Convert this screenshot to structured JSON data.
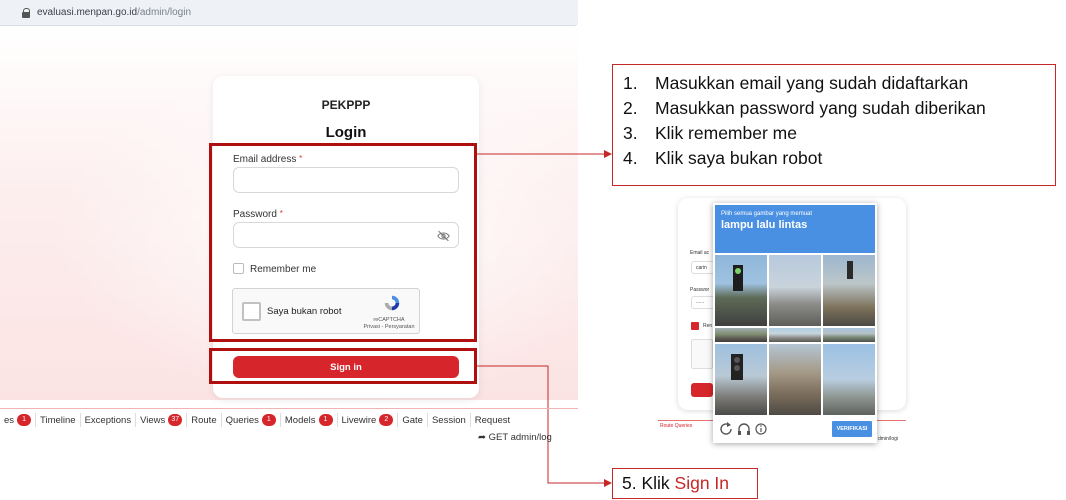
{
  "browser": {
    "domain": "evaluasi.menpan.go.id",
    "path": "/admin/login"
  },
  "login": {
    "brand": "PEKPPP",
    "title": "Login",
    "email_label": "Email address",
    "password_label": "Password",
    "required_mark": "*",
    "remember_label": "Remember me",
    "recaptcha_text": "Saya bukan robot",
    "recaptcha_brand": "reCAPTCHA",
    "recaptcha_links": "Privasi - Persyaratan",
    "signin_label": "Sign in"
  },
  "debugbar": {
    "first_tab_fragment": "es",
    "first_tab_badge": "1",
    "tabs": [
      {
        "label": "Timeline",
        "badge": ""
      },
      {
        "label": "Exceptions",
        "badge": ""
      },
      {
        "label": "Views",
        "badge": "37"
      },
      {
        "label": "Route",
        "badge": ""
      },
      {
        "label": "Queries",
        "badge": "1"
      },
      {
        "label": "Models",
        "badge": "1"
      },
      {
        "label": "Livewire",
        "badge": "2"
      },
      {
        "label": "Gate",
        "badge": ""
      },
      {
        "label": "Session",
        "badge": ""
      },
      {
        "label": "Request",
        "badge": ""
      }
    ],
    "request_line": "GET admin/log"
  },
  "instructions": [
    {
      "num": "1.",
      "text": "Masukkan email yang sudah didaftarkan"
    },
    {
      "num": "2.",
      "text": "Masukkan password yang sudah diberikan"
    },
    {
      "num": "3.",
      "text": "Klik remember me"
    },
    {
      "num": "4.",
      "text": "Klik saya bukan robot"
    }
  ],
  "captcha_popup": {
    "subtitle": "Pilih semua gambar yang memuat",
    "title": "lampu lalu lintas",
    "verify_label": "VERIFIKASI",
    "bg_email_label": "Email ac",
    "bg_email_value": "carin",
    "bg_password_label": "Passwor",
    "bg_password_value": "......",
    "bg_remember": "Ren",
    "bg_debug": "Route  Queries",
    "bg_url": "dmin/logi"
  },
  "step5": {
    "prefix": "5. Klik ",
    "highlight": "Sign In"
  },
  "colors": {
    "accent": "#d7262b",
    "highlight_border": "#b00f0f",
    "captcha_blue": "#4a90e2"
  }
}
